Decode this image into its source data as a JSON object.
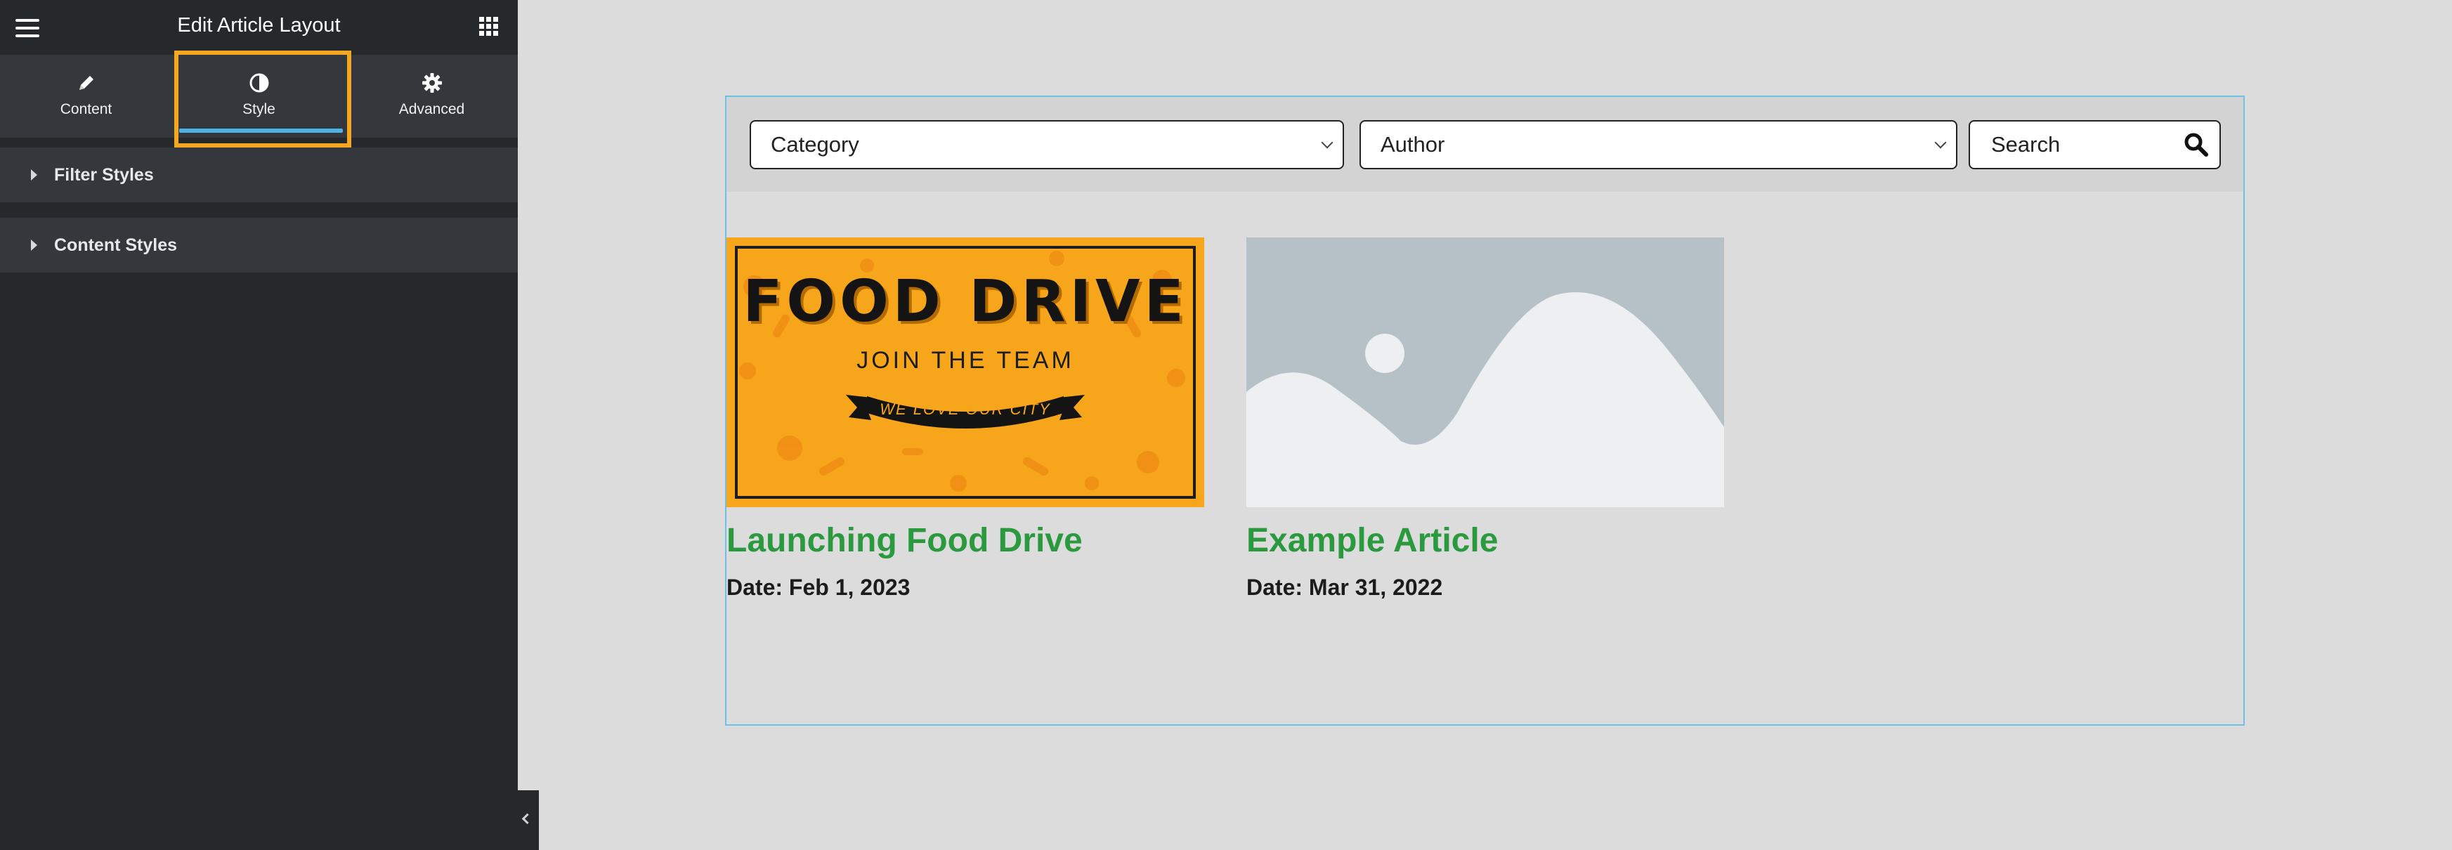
{
  "header": {
    "title": "Edit Article Layout"
  },
  "tabs": [
    {
      "label": "Content",
      "icon": "pencil-icon",
      "active": false
    },
    {
      "label": "Style",
      "icon": "contrast-icon",
      "active": true
    },
    {
      "label": "Advanced",
      "icon": "gear-icon",
      "active": false
    }
  ],
  "sections": [
    {
      "label": "Filter Styles"
    },
    {
      "label": "Content Styles"
    }
  ],
  "filters": {
    "category": "Category",
    "author": "Author",
    "search_placeholder": "Search"
  },
  "articles": [
    {
      "title": "Launching Food Drive",
      "date": "Date: Feb 1, 2023",
      "image": {
        "headline": "FOOD DRIVE",
        "subline": "JOIN THE TEAM",
        "ribbon": "WE LOVE OUR CITY"
      }
    },
    {
      "title": "Example Article",
      "date": "Date: Mar 31, 2022",
      "image": {
        "type": "placeholder"
      }
    }
  ],
  "colors": {
    "highlight": "#f5a623",
    "active_tab": "#4fb3e8",
    "title_green": "#2b9a3f",
    "frame_border": "#6ec1e4"
  }
}
